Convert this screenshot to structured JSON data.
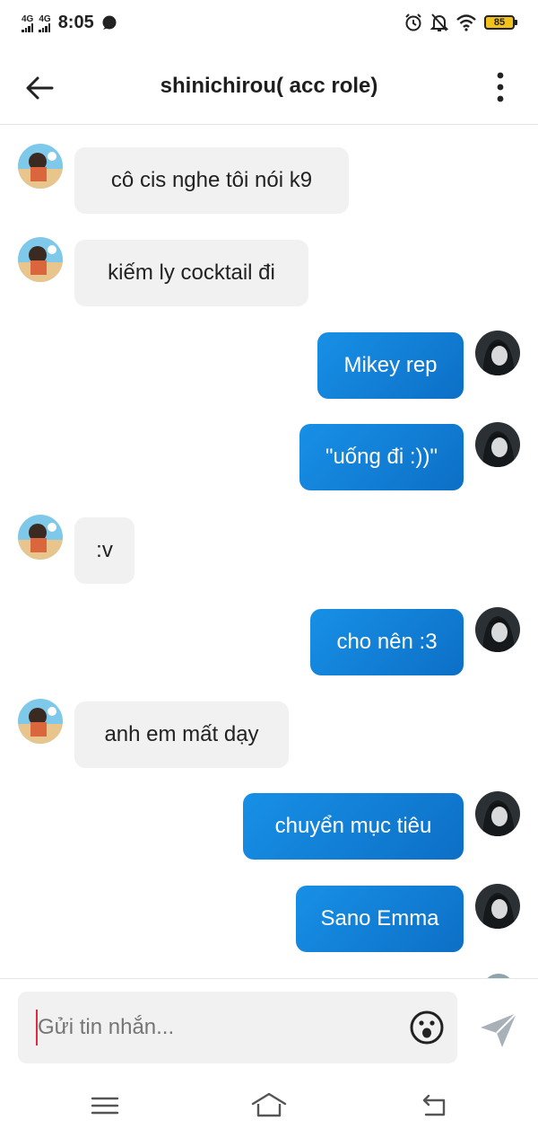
{
  "status_bar": {
    "network_1": "4G",
    "network_2": "4G",
    "time": "8:05",
    "battery": "85",
    "icons": [
      "chat-bubble-icon",
      "alarm-icon",
      "silent-bell-icon",
      "wifi-icon",
      "battery-icon"
    ]
  },
  "header": {
    "title": "shinichirou( acc role)",
    "icons": [
      "back-arrow-icon",
      "more-vertical-icon"
    ]
  },
  "messages": [
    {
      "side": "in",
      "text": "cô cis nghe tôi nói k9"
    },
    {
      "side": "in",
      "text": "kiếm ly cocktail đi"
    },
    {
      "side": "out",
      "text": "Mikey rep"
    },
    {
      "side": "out",
      "text": "\"uống đi :))\""
    },
    {
      "side": "in",
      "text": ":v"
    },
    {
      "side": "out",
      "text": "cho nên :3"
    },
    {
      "side": "in",
      "text": "anh em mất dạy"
    },
    {
      "side": "out",
      "text": "chuyển mục tiêu"
    },
    {
      "side": "out",
      "text": "Sano Emma"
    }
  ],
  "composer": {
    "placeholder": "Gửi tin nhắn...",
    "icons": [
      "emoji-icon",
      "send-icon"
    ]
  },
  "nav_bar": {
    "icons": [
      "menu-icon",
      "home-icon",
      "back-icon"
    ]
  },
  "colors": {
    "outgoing_bubble": "#1484dc",
    "incoming_bubble": "#f1f1f1",
    "battery": "#f2c21a",
    "caret": "#e02a45"
  }
}
